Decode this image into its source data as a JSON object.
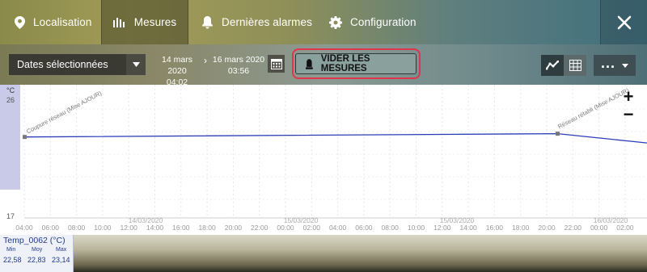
{
  "nav": {
    "tabs": [
      {
        "label": "Localisation",
        "icon": "location-pin-icon"
      },
      {
        "label": "Mesures",
        "icon": "bar-chart-icon",
        "active": true
      },
      {
        "label": "Dernières alarmes",
        "icon": "bell-icon"
      },
      {
        "label": "Configuration",
        "icon": "gear-icon"
      }
    ],
    "close_icon": "close-icon"
  },
  "toolbar": {
    "date_select": "Dates sélectionnées",
    "start_date": "14 mars 2020",
    "start_time": "04:02",
    "end_date": "16 mars 2020",
    "end_time": "03:56",
    "vider_label": "VIDER LES MESURES",
    "more_label": "...",
    "colors": {
      "highlight": "#e0354a"
    }
  },
  "chart_data": {
    "type": "line",
    "yunit": "°C",
    "y_ticks": [
      "26",
      "17"
    ],
    "ylim": [
      17,
      26
    ],
    "x_ticks": [
      "04:00",
      "06:00",
      "08:00",
      "10:00",
      "12:00",
      "14:00",
      "16:00",
      "18:00",
      "20:00",
      "22:00",
      "00:00",
      "02:00",
      "04:00",
      "06:00",
      "08:00",
      "10:00",
      "12:00",
      "14:00",
      "16:00",
      "18:00",
      "20:00",
      "22:00",
      "00:00",
      "02:00"
    ],
    "date_labels": [
      "14/03/2020",
      "15/03/2020",
      "15/03/2020",
      "16/03/2020"
    ],
    "series": [
      {
        "name": "Temp_0062 (°C)",
        "color": "#2a3db5",
        "x": [
          "14/03/2020 04:02",
          "15/03/2020 20:50",
          "16/03/2020 02:30"
        ],
        "y": [
          22.9,
          23.14,
          22.58
        ]
      }
    ],
    "annotations": [
      "Coupure réseau (Mise AJOUR)",
      "Réseau rétabli (Mise AJOUR)"
    ],
    "grid": true
  },
  "stats": {
    "name": "Temp_0062 (°C)",
    "min_label": "Min",
    "moy_label": "Moy",
    "max_label": "Max",
    "min": "22,58",
    "moy": "22,83",
    "max": "23,14"
  }
}
